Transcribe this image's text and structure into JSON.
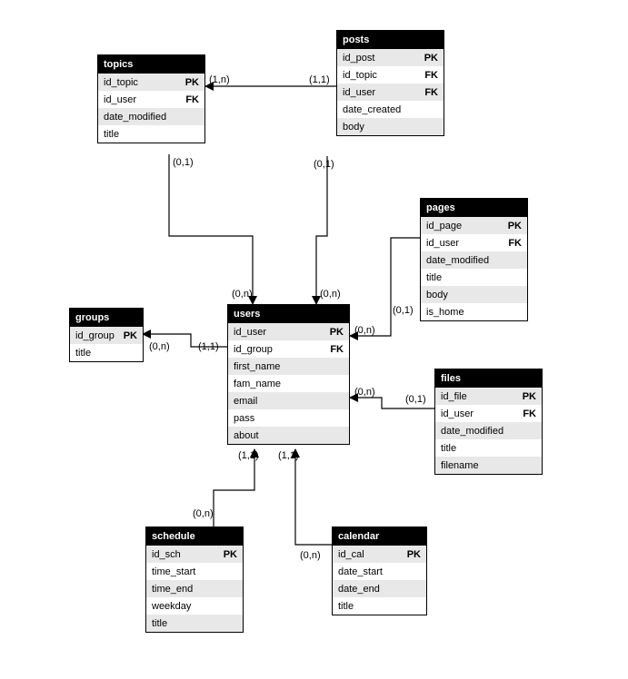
{
  "entities": {
    "topics": {
      "title": "topics",
      "rows": [
        {
          "name": "id_topic",
          "key": "PK"
        },
        {
          "name": "id_user",
          "key": "FK"
        },
        {
          "name": "date_modified",
          "key": ""
        },
        {
          "name": "title",
          "key": ""
        }
      ]
    },
    "posts": {
      "title": "posts",
      "rows": [
        {
          "name": "id_post",
          "key": "PK"
        },
        {
          "name": "id_topic",
          "key": "FK"
        },
        {
          "name": "id_user",
          "key": "FK"
        },
        {
          "name": "date_created",
          "key": ""
        },
        {
          "name": "body",
          "key": ""
        }
      ]
    },
    "pages": {
      "title": "pages",
      "rows": [
        {
          "name": "id_page",
          "key": "PK"
        },
        {
          "name": "id_user",
          "key": "FK"
        },
        {
          "name": "date_modified",
          "key": ""
        },
        {
          "name": "title",
          "key": ""
        },
        {
          "name": "body",
          "key": ""
        },
        {
          "name": "is_home",
          "key": ""
        }
      ]
    },
    "users": {
      "title": "users",
      "rows": [
        {
          "name": "id_user",
          "key": "PK"
        },
        {
          "name": "id_group",
          "key": "FK"
        },
        {
          "name": "first_name",
          "key": ""
        },
        {
          "name": "fam_name",
          "key": ""
        },
        {
          "name": "email",
          "key": ""
        },
        {
          "name": "pass",
          "key": ""
        },
        {
          "name": "about",
          "key": ""
        }
      ]
    },
    "groups": {
      "title": "groups",
      "rows": [
        {
          "name": "id_group",
          "key": "PK"
        },
        {
          "name": "title",
          "key": ""
        }
      ]
    },
    "files": {
      "title": "files",
      "rows": [
        {
          "name": "id_file",
          "key": "PK"
        },
        {
          "name": "id_user",
          "key": "FK"
        },
        {
          "name": "date_modified",
          "key": ""
        },
        {
          "name": "title",
          "key": ""
        },
        {
          "name": "filename",
          "key": ""
        }
      ]
    },
    "schedule": {
      "title": "schedule",
      "rows": [
        {
          "name": "id_sch",
          "key": "PK"
        },
        {
          "name": "time_start",
          "key": ""
        },
        {
          "name": "time_end",
          "key": ""
        },
        {
          "name": "weekday",
          "key": ""
        },
        {
          "name": "title",
          "key": ""
        }
      ]
    },
    "calendar": {
      "title": "calendar",
      "rows": [
        {
          "name": "id_cal",
          "key": "PK"
        },
        {
          "name": "date_start",
          "key": ""
        },
        {
          "name": "date_end",
          "key": ""
        },
        {
          "name": "title",
          "key": ""
        }
      ]
    }
  },
  "cardinalities": {
    "topics_posts_l": "(1,n)",
    "topics_posts_r": "(1,1)",
    "topics_users_t": "(0,1)",
    "topics_users_b": "(0,n)",
    "posts_users_t": "(0,1)",
    "posts_users_b": "(0,n)",
    "groups_users_l": "(0,n)",
    "groups_users_r": "(1,1)",
    "pages_users_t": "(0,1)",
    "pages_users_b": "(0,n)",
    "files_users_t": "(0,1)",
    "files_users_b": "(0,n)",
    "schedule_users": "(0,n)",
    "schedule_users_u": "(1,1)",
    "calendar_users": "(0,n)",
    "calendar_users_u": "(1,1)"
  }
}
